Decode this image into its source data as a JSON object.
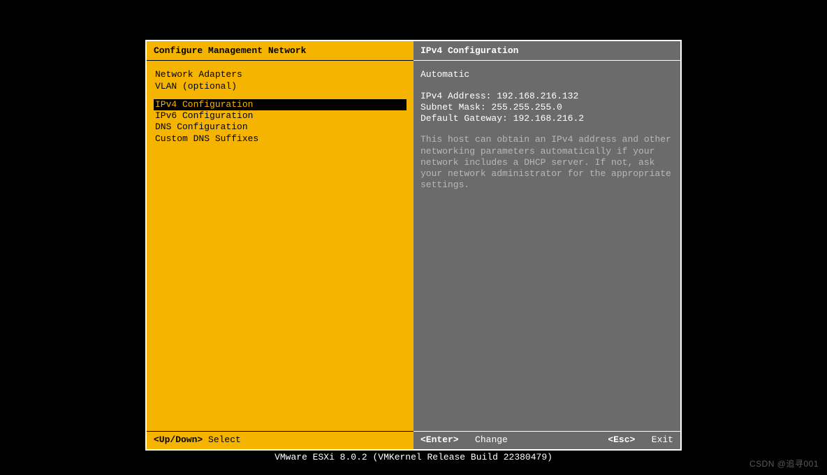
{
  "left": {
    "title": "Configure Management Network",
    "groups": [
      {
        "items": [
          {
            "label": "Network Adapters",
            "selected": false
          },
          {
            "label": "VLAN (optional)",
            "selected": false
          }
        ]
      },
      {
        "items": [
          {
            "label": "IPv4 Configuration",
            "selected": true
          },
          {
            "label": "IPv6 Configuration",
            "selected": false
          },
          {
            "label": "DNS Configuration",
            "selected": false
          },
          {
            "label": "Custom DNS Suffixes",
            "selected": false
          }
        ]
      }
    ]
  },
  "right": {
    "title": "IPv4 Configuration",
    "mode": "Automatic",
    "fields": {
      "address_label": "IPv4 Address:",
      "address_value": "192.168.216.132",
      "mask_label": "Subnet Mask:",
      "mask_value": "255.255.255.0",
      "gateway_label": "Default Gateway:",
      "gateway_value": "192.168.216.2"
    },
    "description": "This host can obtain an IPv4 address and other networking parameters automatically if your network includes a DHCP server. If not, ask your network administrator for the appropriate settings."
  },
  "footer": {
    "left_key": "<Up/Down>",
    "left_action": "Select",
    "right_key1": "<Enter>",
    "right_action1": "Change",
    "right_key2": "<Esc>",
    "right_action2": "Exit"
  },
  "version": "VMware ESXi 8.0.2 (VMKernel Release Build 22380479)",
  "watermark": "CSDN @追寻001"
}
